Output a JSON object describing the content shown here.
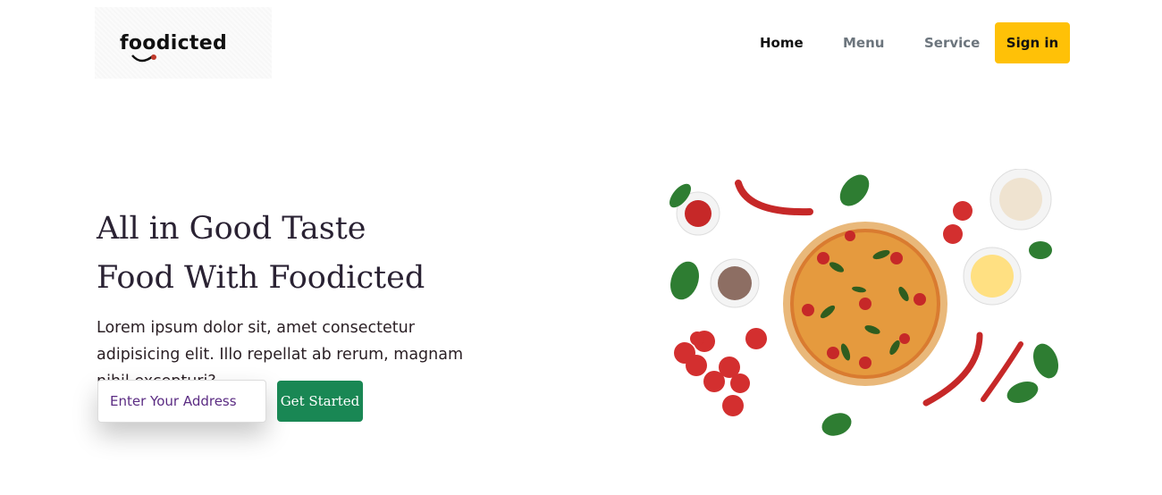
{
  "brand": {
    "logo_text": "foodicted"
  },
  "nav": {
    "home": "Home",
    "menu": "Menu",
    "service": "Service",
    "signin": "Sign in"
  },
  "hero": {
    "title_line1": "All in Good Taste",
    "title_line2": "Food With Foodicted",
    "description": "Lorem ipsum dolor sit, amet consectetur adipisicing elit. Illo repellat ab rerum, magnam nihil excepturi?",
    "address_placeholder": "Enter Your Address",
    "cta_label": "Get Started"
  },
  "colors": {
    "signin_bg": "#ffc107",
    "cta_bg": "#198754",
    "title_text": "#2a2233",
    "placeholder_text": "#5b2c83"
  },
  "icons": {
    "logo": "foodicted-logo",
    "hero_image": "pizza-with-ingredients-illustration"
  }
}
